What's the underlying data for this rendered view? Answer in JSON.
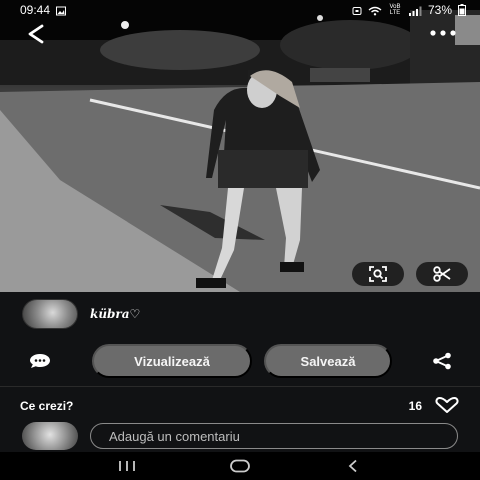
{
  "status_bar": {
    "time": "09:44",
    "network_label": "VoB LTE",
    "battery": "73%"
  },
  "photo": {
    "alt": "Black-and-white street photo of a woman walking at night"
  },
  "author": {
    "name": "kübra♡"
  },
  "actions": {
    "view_label": "Vizualizează",
    "save_label": "Salvează"
  },
  "feedback": {
    "prompt": "Ce crezi?",
    "like_count": "16"
  },
  "comment": {
    "placeholder": "Adaugă un comentariu"
  },
  "icons": {
    "back": "back-arrow-icon",
    "more": "more-dots-icon",
    "lens": "visual-search-icon",
    "scissors": "scissors-icon",
    "comment": "comment-bubble-icon",
    "share": "share-icon",
    "heart": "heart-icon"
  }
}
